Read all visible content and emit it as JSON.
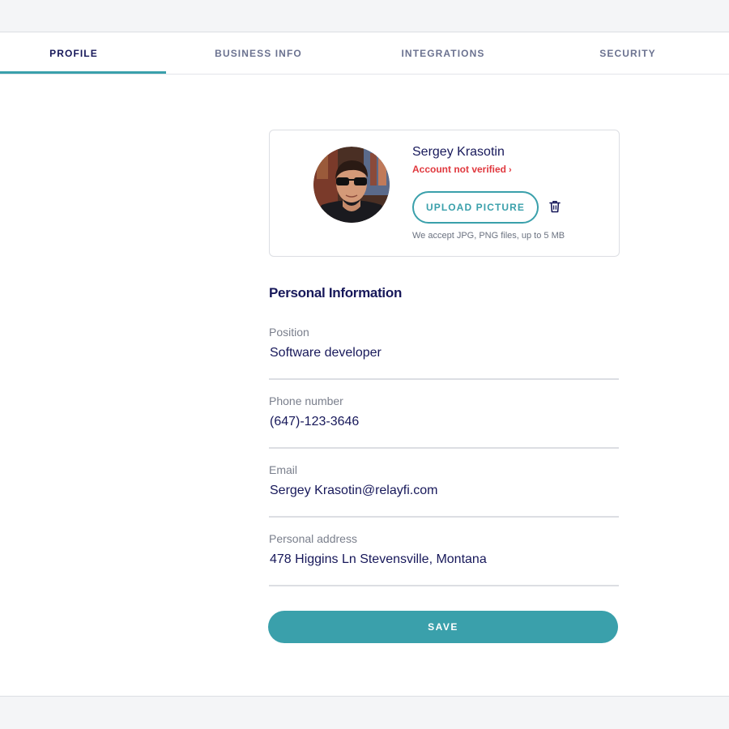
{
  "tabs": [
    {
      "label": "PROFILE",
      "active": true
    },
    {
      "label": "BUSINESS INFO",
      "active": false
    },
    {
      "label": "INTEGRATIONS",
      "active": false
    },
    {
      "label": "SECURITY",
      "active": false
    }
  ],
  "profile": {
    "name": "Sergey Krasotin",
    "verification_status": "Account not verified",
    "verification_chevron": "›",
    "upload_label": "UPLOAD PICTURE",
    "file_hint": "We accept JPG, PNG files, up to 5 MB",
    "avatar_icon": "user-photo",
    "delete_icon": "trash-icon"
  },
  "personal_info": {
    "title": "Personal Information",
    "fields": [
      {
        "label": "Position",
        "value": "Software developer"
      },
      {
        "label": "Phone number",
        "value": "(647)-123-3646"
      },
      {
        "label": "Email",
        "value": "Sergey Krasotin@relayfi.com"
      },
      {
        "label": "Personal address",
        "value": "478 Higgins Ln Stevensville, Montana"
      }
    ]
  },
  "save_label": "SAVE",
  "colors": {
    "accent": "#3aa0ab",
    "heading": "#17185a",
    "error": "#e0383e",
    "muted_tab": "#6b7290",
    "background": "#f4f5f7"
  }
}
